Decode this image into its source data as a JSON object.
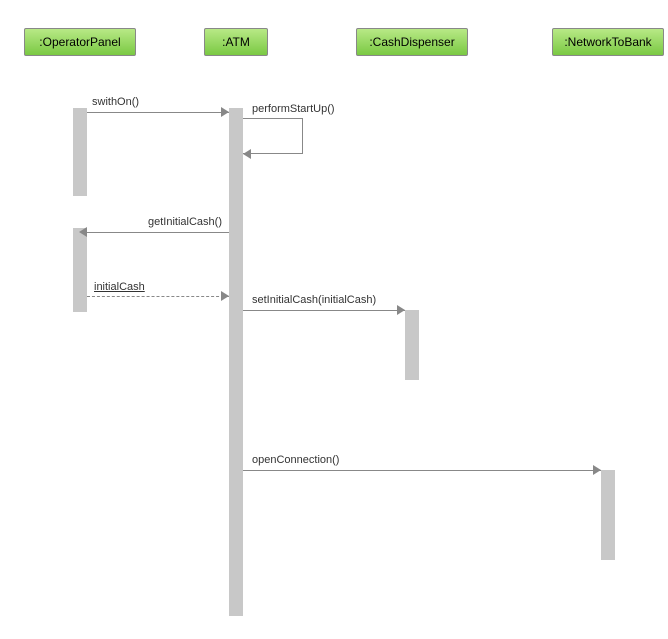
{
  "lifelines": {
    "operatorPanel": ":OperatorPanel",
    "atm": ":ATM",
    "cashDispenser": ":CashDispenser",
    "networkToBank": ":NetworkToBank"
  },
  "messages": {
    "switchOn": "swithOn()",
    "performStartUp": "performStartUp()",
    "getInitialCash": "getInitialCash()",
    "initialCash": "initialCash",
    "setInitialCash": "setInitialCash(initialCash)",
    "openConnection": "openConnection()"
  }
}
